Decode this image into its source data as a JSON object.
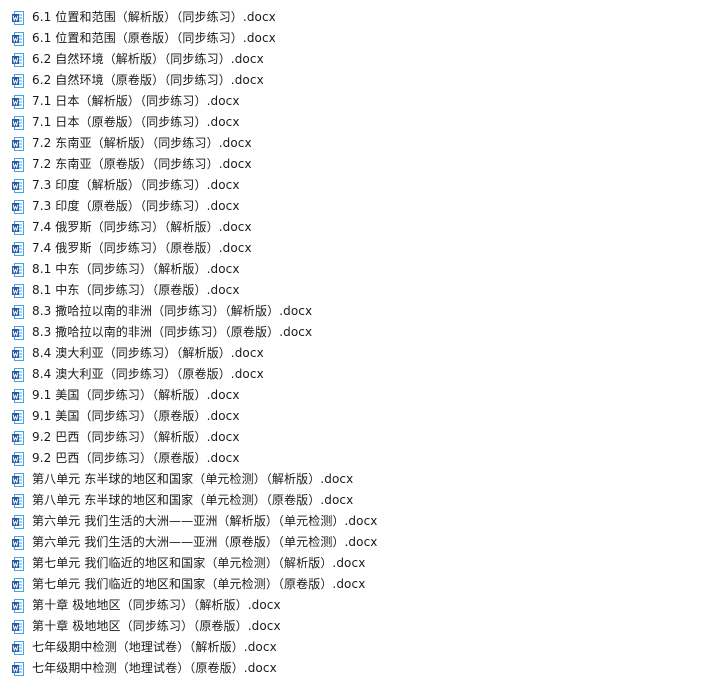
{
  "icon": {
    "name": "word-doc-icon",
    "color": "#2b579a",
    "accent": "#41a5ee"
  },
  "files": [
    "6.1  位置和范围（解析版）（同步练习）.docx",
    "6.1  位置和范围（原卷版）（同步练习）.docx",
    "6.2  自然环境（解析版）（同步练习）.docx",
    "6.2  自然环境（原卷版）（同步练习）.docx",
    "7.1  日本（解析版）（同步练习）.docx",
    "7.1  日本（原卷版）（同步练习）.docx",
    "7.2 东南亚（解析版）（同步练习）.docx",
    "7.2 东南亚（原卷版）（同步练习）.docx",
    "7.3 印度（解析版）（同步练习）.docx",
    "7.3 印度（原卷版）（同步练习）.docx",
    "7.4 俄罗斯（同步练习）（解析版）.docx",
    "7.4 俄罗斯（同步练习）（原卷版）.docx",
    "8.1 中东（同步练习）（解析版）.docx",
    "8.1 中东（同步练习）（原卷版）.docx",
    "8.3 撒哈拉以南的非洲（同步练习）（解析版）.docx",
    "8.3 撒哈拉以南的非洲（同步练习）（原卷版）.docx",
    "8.4 澳大利亚（同步练习）（解析版）.docx",
    "8.4 澳大利亚（同步练习）（原卷版）.docx",
    "9.1  美国（同步练习）（解析版）.docx",
    "9.1  美国（同步练习）（原卷版）.docx",
    "9.2 巴西（同步练习）（解析版）.docx",
    "9.2 巴西（同步练习）（原卷版）.docx",
    "第八单元  东半球的地区和国家（单元检测）（解析版）.docx",
    "第八单元  东半球的地区和国家（单元检测）（原卷版）.docx",
    "第六单元  我们生活的大洲——亚洲（解析版）（单元检测）.docx",
    "第六单元  我们生活的大洲——亚洲（原卷版）（单元检测）.docx",
    "第七单元  我们临近的地区和国家（单元检测）（解析版）.docx",
    "第七单元  我们临近的地区和国家（单元检测）（原卷版）.docx",
    "第十章 极地地区（同步练习）（解析版）.docx",
    "第十章 极地地区（同步练习）（原卷版）.docx",
    "七年级期中检测（地理试卷）（解析版）.docx",
    "七年级期中检测（地理试卷）（原卷版）.docx"
  ]
}
